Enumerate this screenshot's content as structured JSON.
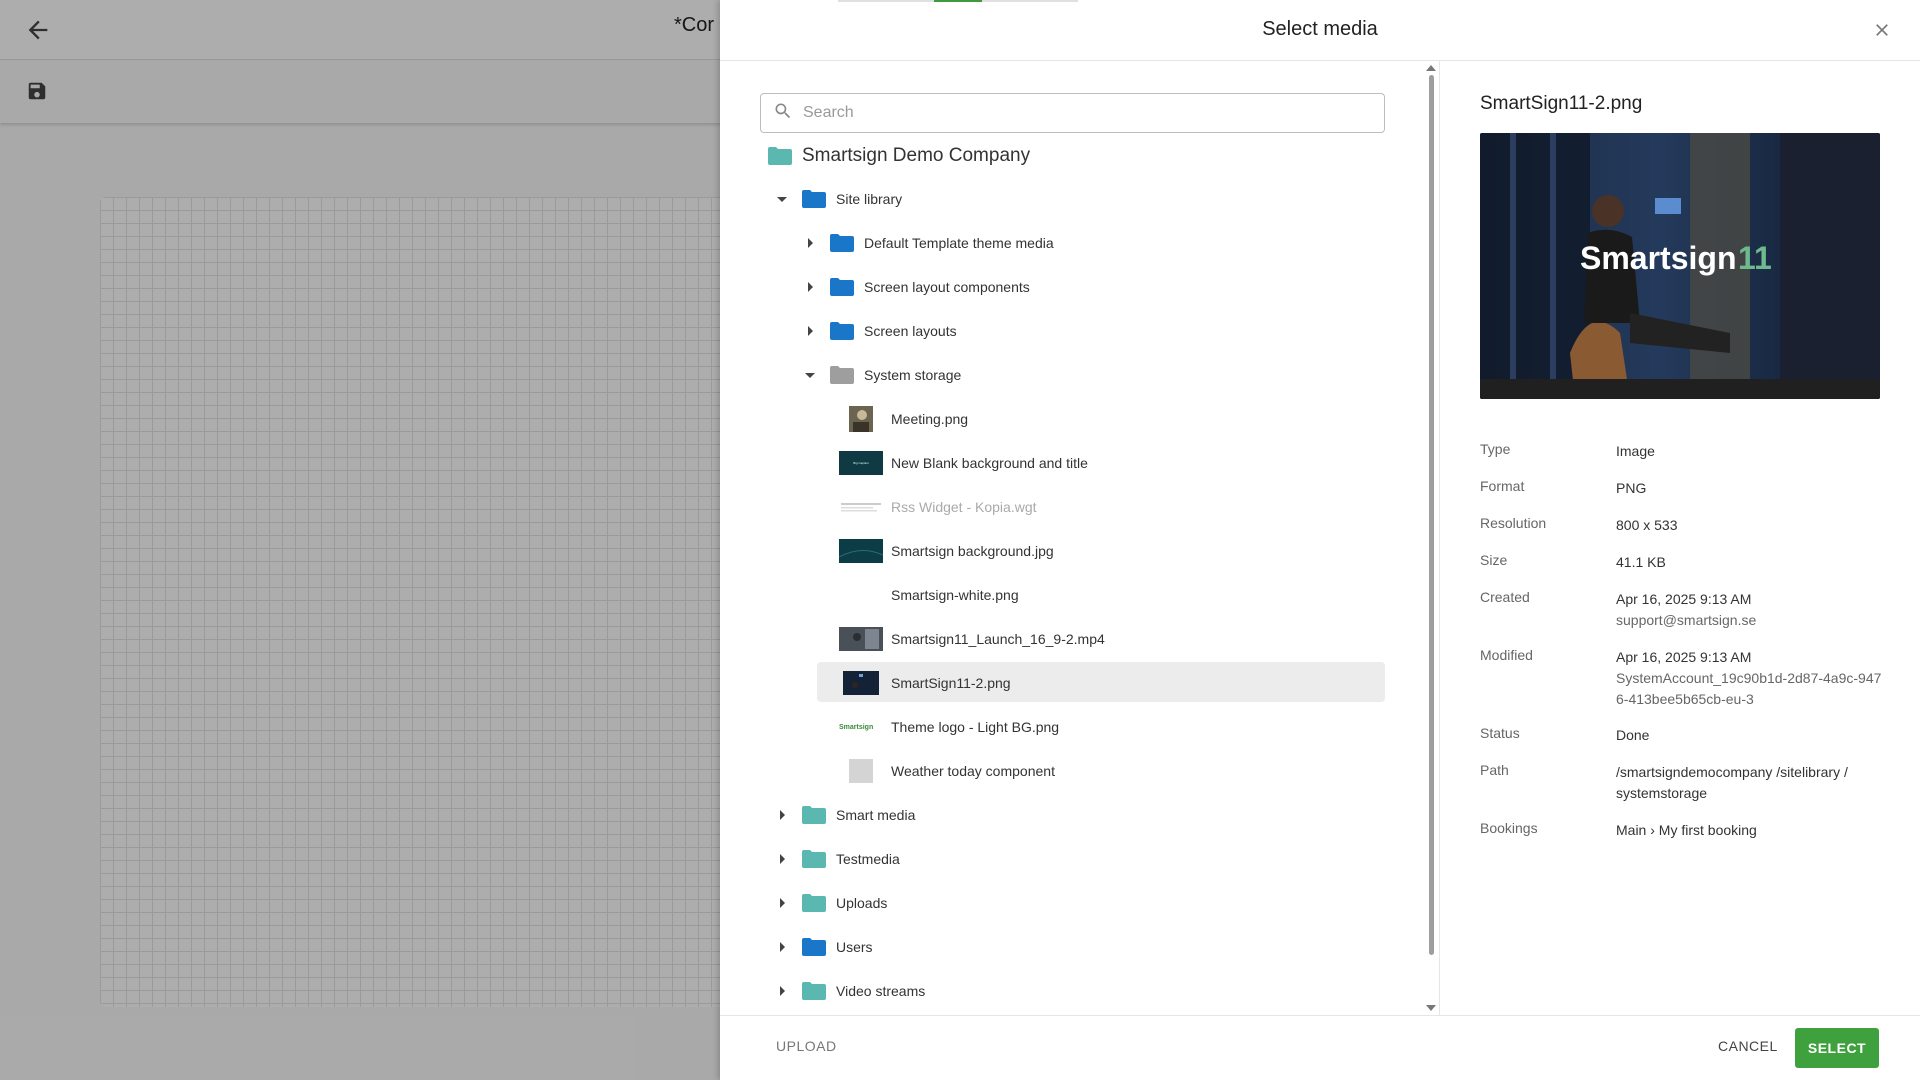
{
  "background": {
    "title": "*Cor",
    "back_icon": "arrow-left-icon",
    "save_icon": "save-icon"
  },
  "dialog": {
    "title": "Select media",
    "close_icon": "close-icon",
    "search": {
      "placeholder": "Search",
      "value": ""
    },
    "tree": {
      "root": "Smartsign Demo Company",
      "site_library": "Site library",
      "default_template": "Default Template theme media",
      "screen_layout_components": "Screen layout components",
      "screen_layouts": "Screen layouts",
      "system_storage": "System storage",
      "files": [
        "Meeting.png",
        "New Blank background and title",
        "Rss Widget - Kopia.wgt",
        "Smartsign background.jpg",
        "Smartsign-white.png",
        "Smartsign11_Launch_16_9-2.mp4",
        "SmartSign11-2.png",
        "Theme logo - Light BG.png",
        "Weather today component"
      ],
      "smart_media": "Smart media",
      "testmedia": "Testmedia",
      "uploads": "Uploads",
      "users": "Users",
      "video_streams": "Video streams",
      "theme_logo_thumb_text": "Smartsign",
      "new_blank_thumb_text": "Big Caption"
    },
    "details": {
      "file_name": "SmartSign11-2.png",
      "preview_text": "Smartsign",
      "preview_number": "11",
      "type_label": "Type",
      "type_value": "Image",
      "format_label": "Format",
      "format_value": "PNG",
      "resolution_label": "Resolution",
      "resolution_value": "800 x 533",
      "size_label": "Size",
      "size_value": "41.1 KB",
      "created_label": "Created",
      "created_value": "Apr 16, 2025 9:13 AM",
      "created_by": "support@smartsign.se",
      "modified_label": "Modified",
      "modified_value": "Apr 16, 2025 9:13 AM",
      "modified_by": "SystemAccount_19c90b1d-2d87-4a9c-9476-413bee5b65cb-eu-3",
      "status_label": "Status",
      "status_value": "Done",
      "path_label": "Path",
      "path_value": "/smartsigndemocompany /sitelibrary / systemstorage",
      "bookings_label": "Bookings",
      "bookings_value": "Main › My first booking"
    },
    "footer": {
      "upload": "UPLOAD",
      "cancel": "CANCEL",
      "select": "SELECT"
    },
    "colors": {
      "accent": "#3ea13e",
      "folder_blue": "#1976c8",
      "folder_teal": "#5bb8b0",
      "folder_grey": "#9e9e9e"
    }
  }
}
